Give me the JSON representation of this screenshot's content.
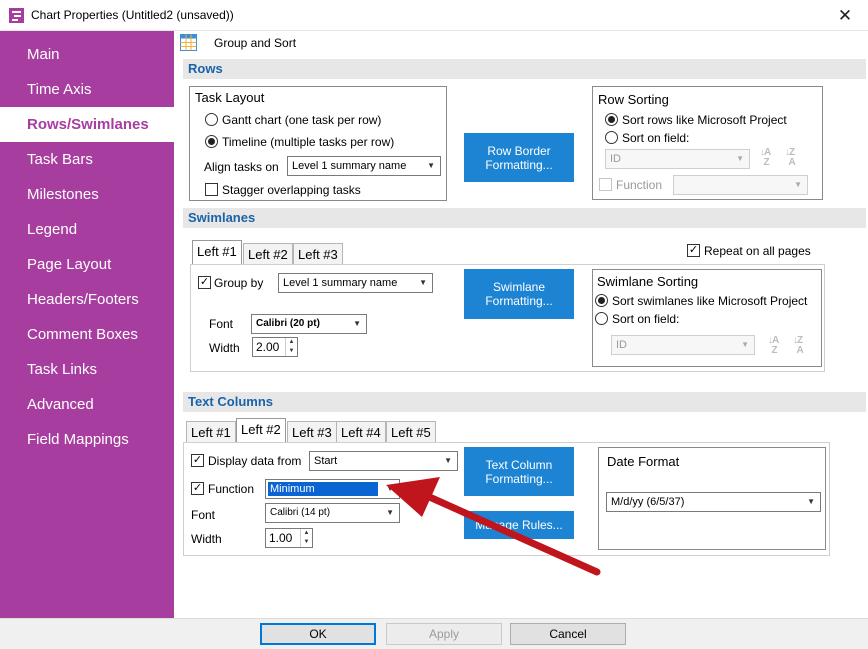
{
  "window": {
    "title": "Chart Properties (Untitled2 (unsaved))",
    "close_glyph": "✕"
  },
  "sidebar": {
    "items": [
      {
        "label": "Main"
      },
      {
        "label": "Time Axis"
      },
      {
        "label": "Rows/Swimlanes",
        "active": true
      },
      {
        "label": "Task Bars"
      },
      {
        "label": "Milestones"
      },
      {
        "label": "Legend"
      },
      {
        "label": "Page Layout"
      },
      {
        "label": "Headers/Footers"
      },
      {
        "label": "Comment Boxes"
      },
      {
        "label": "Task Links"
      },
      {
        "label": "Advanced"
      },
      {
        "label": "Field Mappings"
      }
    ]
  },
  "toolbar": {
    "group_sort_label": "Group and Sort",
    "group_sort_icon": "grid-icon"
  },
  "rows": {
    "header": "Rows",
    "task_layout": {
      "title": "Task Layout",
      "gantt_label": "Gantt chart (one task per row)",
      "timeline_label": "Timeline (multiple tasks per row)",
      "align_label": "Align tasks on",
      "align_value": "Level 1 summary name",
      "stagger_label": "Stagger overlapping tasks"
    },
    "border_button": "Row Border Formatting...",
    "sorting": {
      "title": "Row Sorting",
      "option1": "Sort rows like Microsoft Project",
      "option2": "Sort on field:",
      "field_value": "ID",
      "function_label": "Function",
      "function_value": ""
    }
  },
  "swimlanes": {
    "header": "Swimlanes",
    "tabs": [
      "Left #1",
      "Left #2",
      "Left #3"
    ],
    "repeat_label": "Repeat on all pages",
    "group_by_label": "Group by",
    "group_by_value": "Level 1 summary name",
    "font_label": "Font",
    "font_value": "Calibri (20 pt)",
    "width_label": "Width",
    "width_value": "2.00",
    "format_button": "Swimlane Formatting...",
    "sorting": {
      "title": "Swimlane Sorting",
      "option1": "Sort swimlanes like Microsoft Project",
      "option2": "Sort on field:",
      "field_value": "ID"
    }
  },
  "text_columns": {
    "header": "Text Columns",
    "tabs": [
      "Left #1",
      "Left #2",
      "Left #3",
      "Left #4",
      "Left #5"
    ],
    "display_label": "Display data from",
    "display_value": "Start",
    "function_label": "Function",
    "function_value": "Minimum",
    "font_label": "Font",
    "font_value": "Calibri (14 pt)",
    "width_label": "Width",
    "width_value": "1.00",
    "format_button": "Text Column Formatting...",
    "manage_button": "Manage Rules...",
    "date_format_title": "Date Format",
    "date_format_value": "M/d/yy (6/5/37)"
  },
  "footer": {
    "ok": "OK",
    "apply": "Apply",
    "cancel": "Cancel"
  },
  "colors": {
    "sidebar": "#a83da0",
    "accent_blue": "#1c84d2",
    "header_text": "#1a63a8",
    "arrow": "#c0151c"
  }
}
